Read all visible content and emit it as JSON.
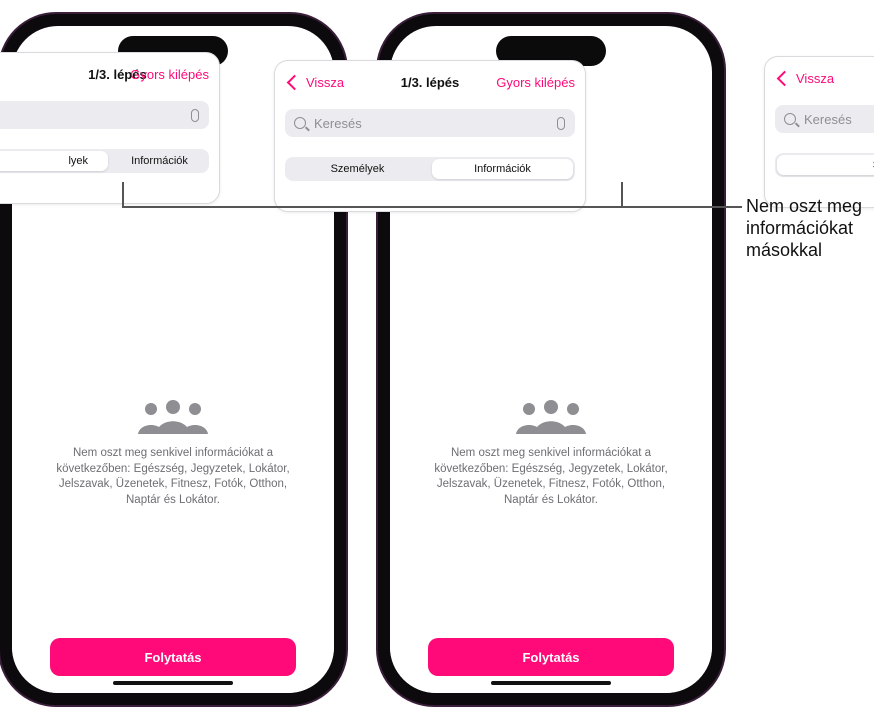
{
  "left_screen": {
    "header": {
      "step_title": "1/3. lépés",
      "quick_exit": "Gyors kilépés"
    },
    "segment": {
      "people": "lyek",
      "info": "Információk"
    },
    "empty_state": {
      "icon": "people-group-icon",
      "text": "Nem oszt meg senkivel információkat a következőben: Egészség, Jegyzetek, Lokátor, Jelszavak, Üzenetek, Fitnesz, Fotók, Otthon, Naptár és Lokátor."
    },
    "continue_button": "Folytatás"
  },
  "right_screen": {
    "header": {
      "back": "Vissza",
      "step_title": "1/3. lépés",
      "quick_exit": "Gyors kilépés"
    },
    "search": {
      "placeholder": "Keresés"
    },
    "segment": {
      "people": "Személyek",
      "info": "Információk"
    },
    "empty_state": {
      "icon": "people-group-icon",
      "text": "Nem oszt meg senkivel információkat a következőben: Egészség, Jegyzetek, Lokátor, Jelszavak, Üzenetek, Fitnesz, Fotók, Otthon, Naptár és Lokátor."
    },
    "continue_button": "Folytatás"
  },
  "far_screen": {
    "header": {
      "back": "Vissza"
    },
    "search": {
      "placeholder": "Keresés"
    },
    "segment": {
      "people": "Szemé"
    }
  },
  "callout": {
    "line1": "Nem oszt meg",
    "line2": "információkat",
    "line3": "másokkal"
  },
  "colors": {
    "accent": "#ff0a78",
    "text_secondary": "#6e6e73",
    "frame": "#0c0a0d"
  }
}
